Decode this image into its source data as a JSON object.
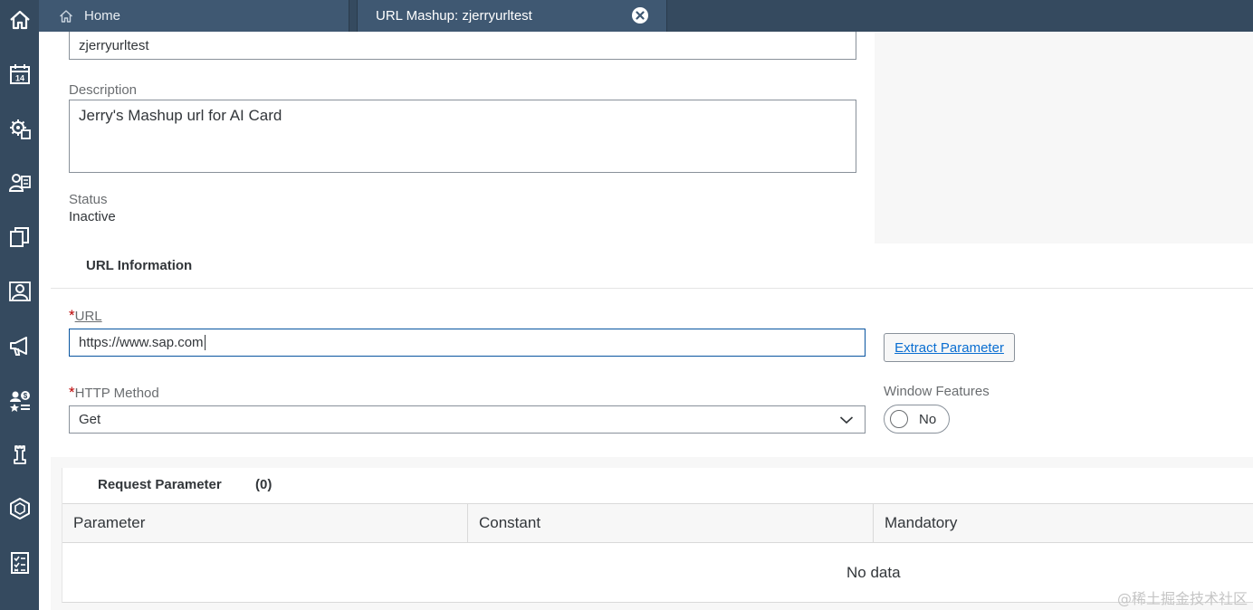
{
  "tabs": {
    "home_label": "Home",
    "active_label": "URL Mashup: zjerryurltest"
  },
  "rail_icons": [
    "home-icon",
    "calendar-icon",
    "settings-group-icon",
    "contacts-icon",
    "copy-icon",
    "users-icon",
    "megaphone-icon",
    "customer-rating-icon",
    "chess-rook-icon",
    "product-box-icon",
    "checklist-icon"
  ],
  "calendar_day": "14",
  "form": {
    "name_value": "zjerryurltest",
    "description_label": "Description",
    "description_value": "Jerry's Mashup url for AI Card",
    "status_label": "Status",
    "status_value": "Inactive"
  },
  "url_section": {
    "title": "URL Information",
    "url_required_mark": "*",
    "url_label": "URL",
    "url_value": "https://www.sap.com",
    "extract_button": "Extract Parameter",
    "http_required_mark": "*",
    "http_label": "HTTP Method",
    "http_value": "Get",
    "window_features_label": "Window Features",
    "window_features_value": "No"
  },
  "request_params": {
    "title": "Request Parameter",
    "count": "(0)",
    "columns": [
      "Parameter",
      "Constant",
      "Mandatory"
    ],
    "empty_text": "No data"
  },
  "watermark": "@稀土掘金技术社区"
}
